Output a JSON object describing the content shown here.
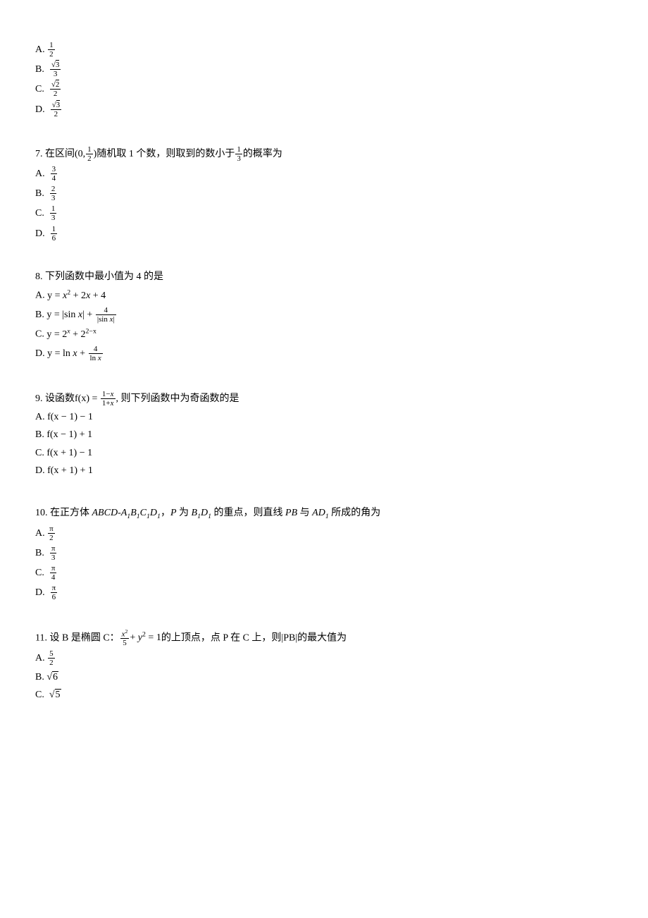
{
  "q6": {
    "optA": {
      "label": "A.",
      "num": "1",
      "den": "2"
    },
    "optB": {
      "label": "B.",
      "num_sqrt": "3",
      "den": "3"
    },
    "optC": {
      "label": "C.",
      "num_sqrt": "2",
      "den": "2"
    },
    "optD": {
      "label": "D.",
      "num_sqrt": "3",
      "den": "2"
    }
  },
  "q7": {
    "stem_pre": "7. 在区间(0,",
    "stem_frac_num": "1",
    "stem_frac_den": "2",
    "stem_mid": ")随机取 1 个数，则取到的数小于",
    "stem_frac2_num": "1",
    "stem_frac2_den": "3",
    "stem_post": "的概率为",
    "optA": {
      "label": "A.",
      "num": "3",
      "den": "4"
    },
    "optB": {
      "label": "B.",
      "num": "2",
      "den": "3"
    },
    "optC": {
      "label": "C.",
      "num": "1",
      "den": "3"
    },
    "optD": {
      "label": "D.",
      "num": "1",
      "den": "6"
    }
  },
  "q8": {
    "stem": "8. 下列函数中最小值为 4 的是",
    "optA_label": "A.",
    "optA_expr": "y = x² + 2x + 4",
    "optB_label": "B.",
    "optB_pre": "y = |sin x| + ",
    "optB_frac_num": "4",
    "optB_frac_den": "|sin x|",
    "optC_label": "C.",
    "optC_pre": "y = 2",
    "optC_sup1": "x",
    "optC_mid": " + 2",
    "optC_sup2": "2−x",
    "optD_label": "D.",
    "optD_pre": "y = ln x + ",
    "optD_frac_num": "4",
    "optD_frac_den": "ln x"
  },
  "q9": {
    "stem_pre": "9. 设函数f(x) = ",
    "stem_frac_num": "1−x",
    "stem_frac_den": "1+x",
    "stem_post": ", 则下列函数中为奇函数的是",
    "optA": "A. f(x − 1) − 1",
    "optB": "B. f(x − 1) + 1",
    "optC": "C. f(x + 1) − 1",
    "optD": "D. f(x + 1) + 1"
  },
  "q10": {
    "stem_pre": "10. 在正方体 ",
    "stem_cube1": "ABCD",
    "stem_dash": "-",
    "stem_cube2_A": "A",
    "stem_cube2_B": "B",
    "stem_cube2_C": "C",
    "stem_cube2_D": "D",
    "stem_sub": "1",
    "stem_mid": "，",
    "stem_P": "P",
    "stem_mid2": " 为 ",
    "stem_B1D1_B": "B",
    "stem_B1D1_D": "D",
    "stem_mid3": " 的重点，则直线 ",
    "stem_PB": "PB",
    "stem_mid4": " 与 ",
    "stem_AD1_A": "A",
    "stem_AD1_D": "D",
    "stem_post": " 所成的角为",
    "optA": {
      "label": "A.",
      "num": "π",
      "den": "2"
    },
    "optB": {
      "label": "B.",
      "num": "π",
      "den": "3"
    },
    "optC": {
      "label": "C.",
      "num": "π",
      "den": "4"
    },
    "optD": {
      "label": "D.",
      "num": "π",
      "den": "6"
    }
  },
  "q11": {
    "stem_pre": "11. 设 B 是椭圆 C：",
    "stem_frac_num": "x²",
    "stem_frac_den": "5",
    "stem_mid": "+ y² = 1的上顶点，点 P 在 C 上，则|PB|的最大值为",
    "optA": {
      "label": "A.",
      "num": "5",
      "den": "2"
    },
    "optB_label": "B.",
    "optB_sqrt": "6",
    "optC_label": "C.",
    "optC_sqrt": "5"
  }
}
